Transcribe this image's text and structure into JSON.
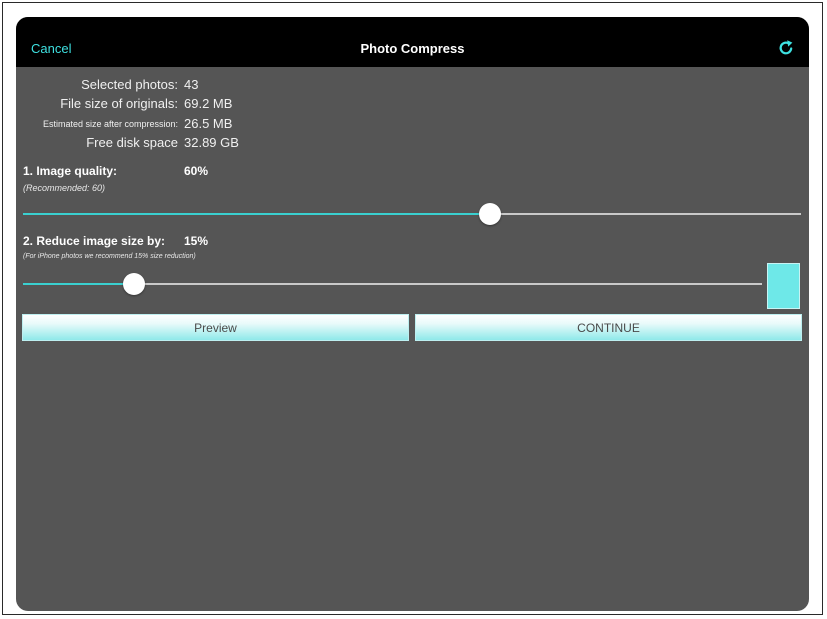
{
  "navbar": {
    "cancel_label": "Cancel",
    "title": "Photo Compress",
    "refresh_icon": "refresh-icon"
  },
  "info": [
    {
      "label": "Selected photos:",
      "value": "43"
    },
    {
      "label": "File size of originals:",
      "value": "69.2 MB"
    },
    {
      "label": "Estimated size after compression:",
      "value": "26.5 MB"
    },
    {
      "label": "Free disk space",
      "value": "32.89 GB"
    }
  ],
  "quality": {
    "title": "1. Image quality:",
    "value": "60%",
    "note": "(Recommended: 60)",
    "slider_level_percent": 60
  },
  "reduce": {
    "title": "2. Reduce image size by:",
    "value": "15%",
    "note": "(For iPhone photos we recommend 15% size reduction)",
    "slider_level_percent": 15
  },
  "buttons": {
    "preview_label": "Preview",
    "continue_label": "CONTINUE"
  },
  "colors": {
    "accent": "#3ee0e0",
    "background": "#555555",
    "navbar": "#000000",
    "swatch": "#6ee8e8"
  }
}
